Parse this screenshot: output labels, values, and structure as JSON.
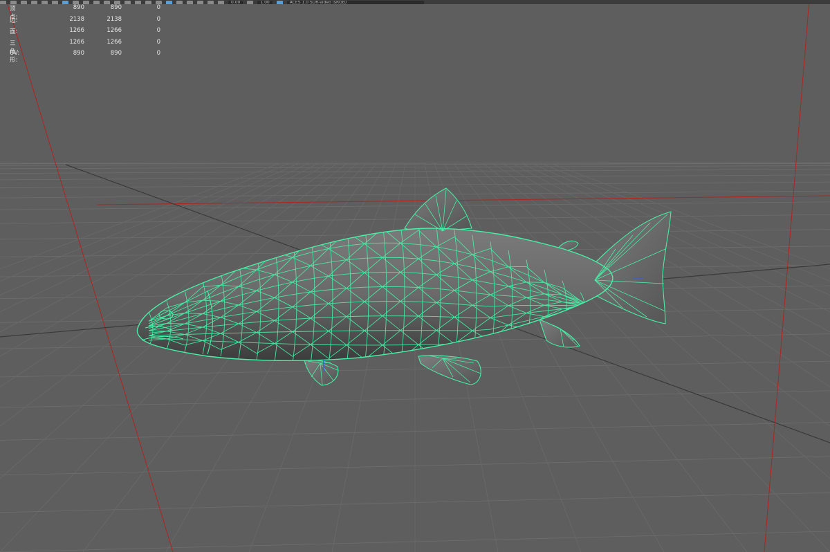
{
  "toolbar": {
    "field_a": "0.00",
    "field_b": "1.00",
    "color_space": "ACES 1.0 SDR-video (sRGB)"
  },
  "heads_up_stats": [
    {
      "label": "顶点:",
      "selected": "890",
      "total": "890",
      "extra": "0"
    },
    {
      "label": "边:",
      "selected": "2138",
      "total": "2138",
      "extra": "0"
    },
    {
      "label": "面:",
      "selected": "1266",
      "total": "1266",
      "extra": "0"
    },
    {
      "label": "三角形:",
      "selected": "1266",
      "total": "1266",
      "extra": "0"
    },
    {
      "label": "UV:",
      "selected": "890",
      "total": "890",
      "extra": "0"
    }
  ],
  "colors": {
    "viewport_bg": "#5e5e5e",
    "grid_line": "#6b6b6b",
    "axis_red": "#b0241f",
    "wire_green": "#46f0a6"
  },
  "viewport": {
    "object": "fish-mesh",
    "display_mode": "wireframe-on-shaded"
  }
}
